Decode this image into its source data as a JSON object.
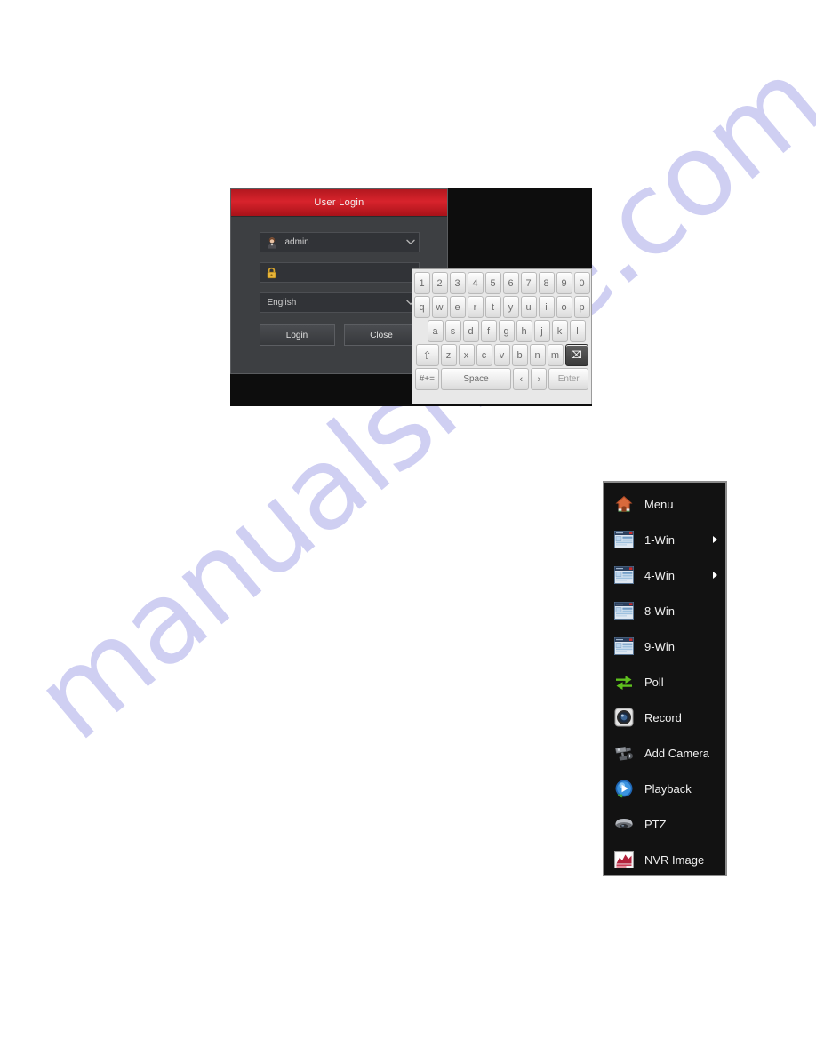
{
  "watermark": {
    "text": "manualshive.com",
    "color": "#cdcdf2"
  },
  "login_dialog": {
    "title": "User Login",
    "user_field": {
      "icon": "user-icon",
      "value": "admin",
      "chevron": "chevron-down-icon"
    },
    "password_field": {
      "icon": "lock-icon",
      "value": "",
      "placeholder": ""
    },
    "language_field": {
      "value": "English",
      "chevron": "chevron-down-icon"
    },
    "login_button": "Login",
    "close_button": "Close"
  },
  "keyboard": {
    "row_numbers": [
      "1",
      "2",
      "3",
      "4",
      "5",
      "6",
      "7",
      "8",
      "9",
      "0"
    ],
    "row_top": [
      "q",
      "w",
      "e",
      "r",
      "t",
      "y",
      "u",
      "i",
      "o",
      "p"
    ],
    "row_home": [
      "a",
      "s",
      "d",
      "f",
      "g",
      "h",
      "j",
      "k",
      "l"
    ],
    "row_bottom": [
      "z",
      "x",
      "c",
      "v",
      "b",
      "n",
      "m"
    ],
    "shift_key": "⇧",
    "backspace_key": "⌧",
    "symbol_key": "#+=",
    "space_key": "Space",
    "left_arrow_key": "‹",
    "right_arrow_key": "›",
    "enter_key": "Enter"
  },
  "context_menu": {
    "items": [
      {
        "label": "Menu",
        "icon": "house-icon",
        "has_submenu": false
      },
      {
        "label": "1-Win",
        "icon": "window-icon",
        "has_submenu": true
      },
      {
        "label": "4-Win",
        "icon": "window-icon",
        "has_submenu": true
      },
      {
        "label": "8-Win",
        "icon": "window-icon",
        "has_submenu": false
      },
      {
        "label": "9-Win",
        "icon": "window-icon",
        "has_submenu": false
      },
      {
        "label": "Poll",
        "icon": "refresh-icon",
        "has_submenu": false
      },
      {
        "label": "Record",
        "icon": "record-icon",
        "has_submenu": false
      },
      {
        "label": "Add Camera",
        "icon": "camera-icon",
        "has_submenu": false
      },
      {
        "label": "Playback",
        "icon": "play-icon",
        "has_submenu": false
      },
      {
        "label": "PTZ",
        "icon": "dome-camera-icon",
        "has_submenu": false
      },
      {
        "label": "NVR Image",
        "icon": "chart-icon",
        "has_submenu": false
      }
    ]
  }
}
